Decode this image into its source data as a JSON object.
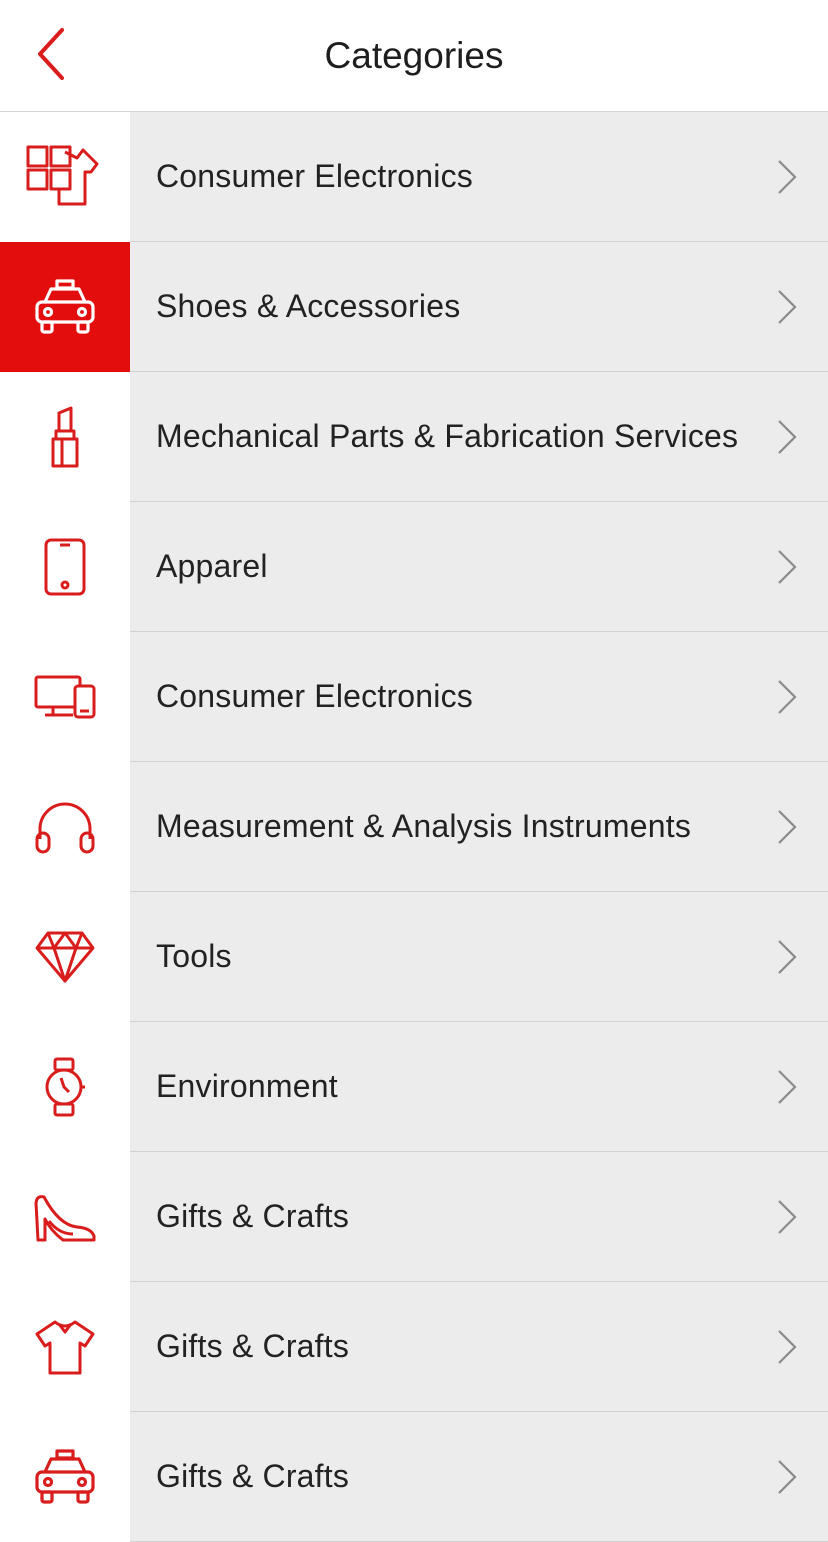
{
  "header": {
    "title": "Categories",
    "back_icon": "chevron-left-icon",
    "accent_color": "#d91c1c"
  },
  "colors": {
    "accent": "#e30d0d",
    "row_background": "#ececec",
    "text": "#222222"
  },
  "categories": [
    {
      "label": "Consumer Electronics",
      "icon": "apps-icon",
      "selected": false
    },
    {
      "label": "Shoes & Accessories",
      "icon": "taxi-icon",
      "selected": true
    },
    {
      "label": "Mechanical Parts & Fabrication Services",
      "icon": "lipstick-icon",
      "selected": false
    },
    {
      "label": "Apparel",
      "icon": "phone-icon",
      "selected": false
    },
    {
      "label": "Consumer Electronics",
      "icon": "devices-icon",
      "selected": false
    },
    {
      "label": "Measurement & Analysis Instruments",
      "icon": "headphones-icon",
      "selected": false
    },
    {
      "label": "Tools",
      "icon": "diamond-icon",
      "selected": false
    },
    {
      "label": "Environment",
      "icon": "watch-icon",
      "selected": false
    },
    {
      "label": "Gifts & Crafts",
      "icon": "high-heel-icon",
      "selected": false
    },
    {
      "label": "Gifts & Crafts",
      "icon": "t-shirt-icon",
      "selected": false
    },
    {
      "label": "Gifts & Crafts",
      "icon": "taxi-icon",
      "selected": false
    }
  ]
}
